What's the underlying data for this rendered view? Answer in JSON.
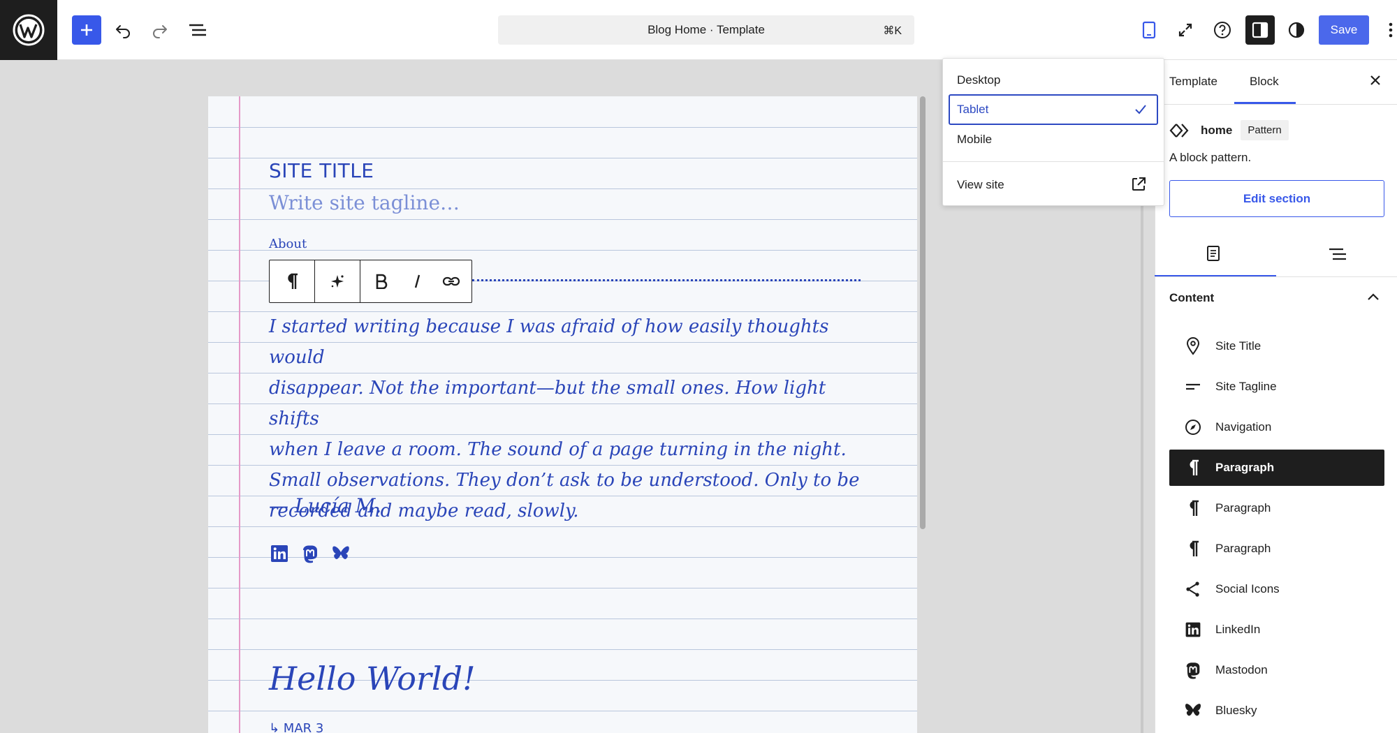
{
  "header": {
    "document_title": "Blog Home · Template",
    "shortcut": "⌘K",
    "save_label": "Save"
  },
  "device_menu": {
    "items": [
      "Desktop",
      "Tablet",
      "Mobile"
    ],
    "selected": "Tablet",
    "view_site": "View site"
  },
  "canvas": {
    "site_title": "SITE TITLE",
    "tagline_placeholder": "Write site tagline…",
    "about_heading": "About",
    "body_lines": [
      "I started writing because I was afraid of how easily thoughts would",
      "disappear. Not the important—but the small ones. How light shifts",
      "when I leave a room. The sound of a page turning in the night.",
      "Small observations. They don’t ask to be understood. Only to be",
      "recorded and maybe read, slowly."
    ],
    "signature": "— Lucía M.",
    "post_title": "Hello World!",
    "post_date": "↳ MAR 3"
  },
  "sidebar": {
    "tabs": [
      "Template",
      "Block"
    ],
    "active_tab": "Block",
    "pattern_name": "home",
    "pattern_badge": "Pattern",
    "pattern_description": "A block pattern.",
    "edit_section_label": "Edit section",
    "content_heading": "Content",
    "content_items": [
      {
        "label": "Site Title",
        "icon": "location-pin-icon"
      },
      {
        "label": "Site Tagline",
        "icon": "tagline-icon"
      },
      {
        "label": "Navigation",
        "icon": "compass-icon"
      },
      {
        "label": "Paragraph",
        "icon": "paragraph-icon",
        "active": true
      },
      {
        "label": "Paragraph",
        "icon": "paragraph-icon"
      },
      {
        "label": "Paragraph",
        "icon": "paragraph-icon"
      },
      {
        "label": "Social Icons",
        "icon": "share-icon"
      },
      {
        "label": "LinkedIn",
        "icon": "linkedin-icon"
      },
      {
        "label": "Mastodon",
        "icon": "mastodon-icon"
      },
      {
        "label": "Bluesky",
        "icon": "bluesky-icon"
      }
    ]
  },
  "colors": {
    "accent": "#3858e9",
    "ink": "#2a45b8",
    "margin_line": "#e59ac8",
    "dark": "#1e1e1e"
  }
}
